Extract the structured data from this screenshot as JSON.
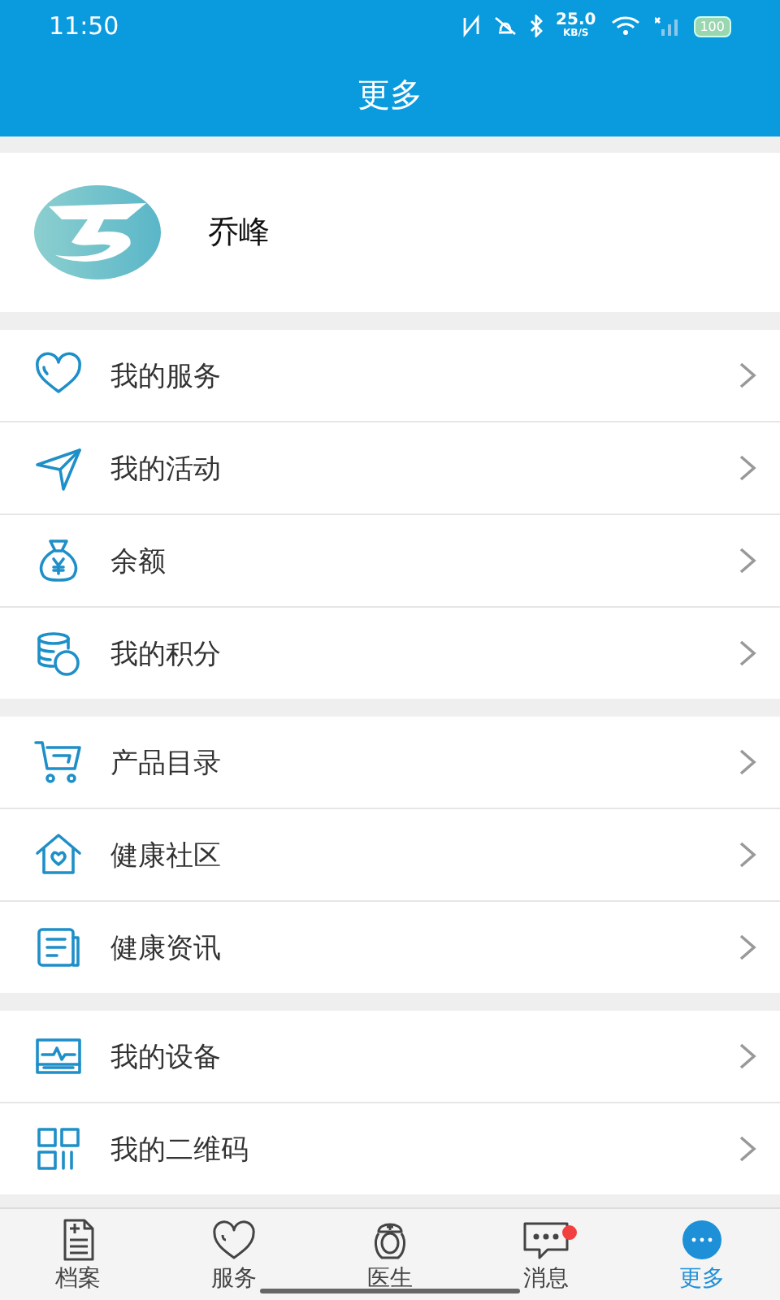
{
  "status_bar": {
    "time": "11:50",
    "speed_value": "25.0",
    "speed_unit": "KB/S",
    "battery": "100"
  },
  "header": {
    "title": "更多"
  },
  "profile": {
    "name": "乔峰"
  },
  "menu_groups": [
    {
      "items": [
        {
          "kind": "heart",
          "label": "我的服务"
        },
        {
          "kind": "send",
          "label": "我的活动"
        },
        {
          "kind": "moneybag",
          "label": "余额"
        },
        {
          "kind": "coins",
          "label": "我的积分"
        }
      ]
    },
    {
      "items": [
        {
          "kind": "cart",
          "label": "产品目录"
        },
        {
          "kind": "house",
          "label": "健康社区"
        },
        {
          "kind": "news",
          "label": "健康资讯"
        }
      ]
    },
    {
      "items": [
        {
          "kind": "monitor",
          "label": "我的设备"
        },
        {
          "kind": "qr",
          "label": "我的二维码"
        }
      ]
    }
  ],
  "tab_bar": [
    {
      "kind": "file",
      "label": "档案",
      "selected": false,
      "badge": false
    },
    {
      "kind": "heart",
      "label": "服务",
      "selected": false,
      "badge": false
    },
    {
      "kind": "nurse",
      "label": "医生",
      "selected": false,
      "badge": false
    },
    {
      "kind": "chat",
      "label": "消息",
      "selected": false,
      "badge": true
    },
    {
      "kind": "more",
      "label": "更多",
      "selected": true,
      "badge": false
    }
  ]
}
